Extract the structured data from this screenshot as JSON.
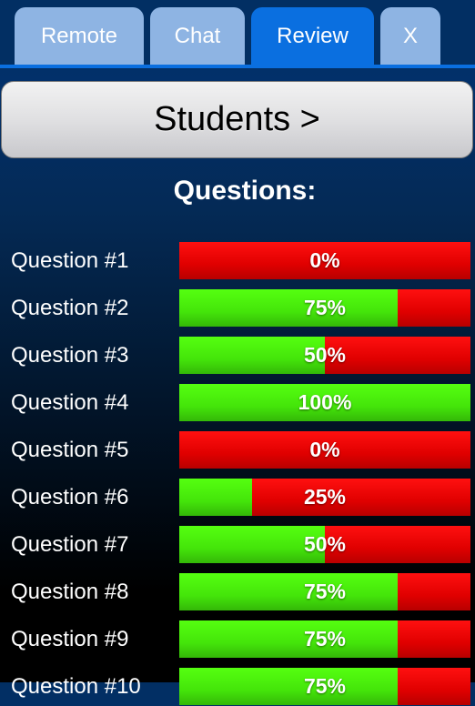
{
  "tabs": [
    {
      "label": "Remote",
      "active": false
    },
    {
      "label": "Chat",
      "active": false
    },
    {
      "label": "Review",
      "active": true
    },
    {
      "label": "X",
      "active": false
    }
  ],
  "students_button": {
    "label": "Students >"
  },
  "questions_heading": "Questions:",
  "questions": [
    {
      "label": "Question #1",
      "percent": 0,
      "percent_label": "0%"
    },
    {
      "label": "Question #2",
      "percent": 75,
      "percent_label": "75%"
    },
    {
      "label": "Question #3",
      "percent": 50,
      "percent_label": "50%"
    },
    {
      "label": "Question #4",
      "percent": 100,
      "percent_label": "100%"
    },
    {
      "label": "Question #5",
      "percent": 0,
      "percent_label": "0%"
    },
    {
      "label": "Question #6",
      "percent": 25,
      "percent_label": "25%"
    },
    {
      "label": "Question #7",
      "percent": 50,
      "percent_label": "50%"
    },
    {
      "label": "Question #8",
      "percent": 75,
      "percent_label": "75%"
    },
    {
      "label": "Question #9",
      "percent": 75,
      "percent_label": "75%"
    },
    {
      "label": "Question #10",
      "percent": 75,
      "percent_label": "75%"
    }
  ],
  "colors": {
    "correct": "#44e50a",
    "incorrect": "#e00000",
    "active_tab": "#0a6fe0",
    "tab": "#8eb4e3"
  }
}
